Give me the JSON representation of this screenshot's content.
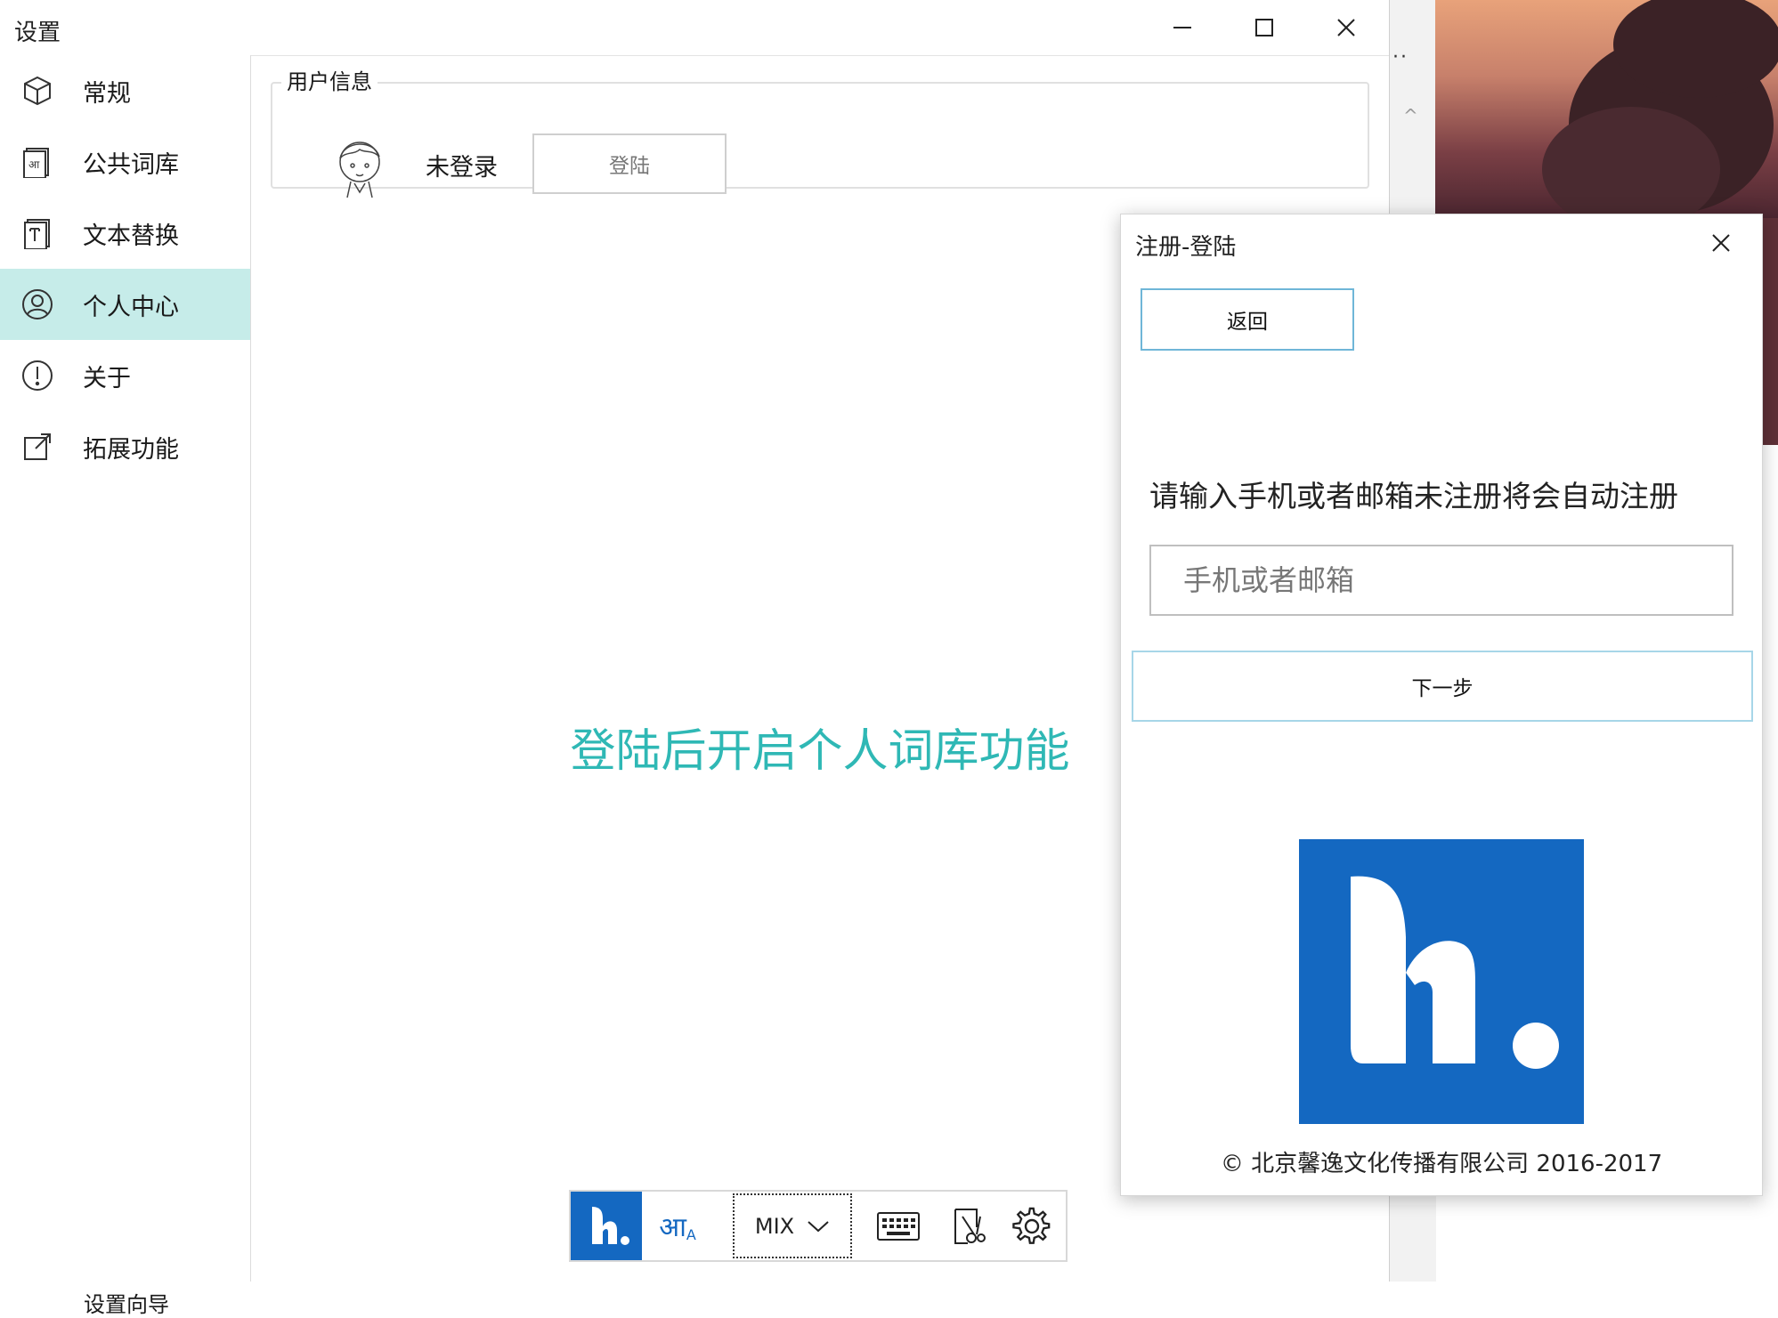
{
  "main_window": {
    "title": "设置",
    "controls": {
      "minimize": "minimize",
      "maximize": "maximize",
      "close": "close"
    }
  },
  "sidebar": {
    "items": [
      {
        "label": "常规",
        "icon": "cube-icon",
        "active": false
      },
      {
        "label": "公共词库",
        "icon": "dictionary-icon",
        "active": false
      },
      {
        "label": "文本替换",
        "icon": "text-replace-icon",
        "active": false
      },
      {
        "label": "个人中心",
        "icon": "user-icon",
        "active": true
      },
      {
        "label": "关于",
        "icon": "info-icon",
        "active": false
      },
      {
        "label": "拓展功能",
        "icon": "external-link-icon",
        "active": false
      }
    ],
    "wizard": "设置向导"
  },
  "user_info": {
    "legend": "用户信息",
    "status": "未登录",
    "login_button": "登陆",
    "avatar": "avatar-sketch"
  },
  "main_message": "登陆后开启个人词库功能",
  "toolbar": {
    "logo_icon": "h-logo-icon",
    "lang_glyph": "आ",
    "lang_sub": "A",
    "mode": "MIX",
    "icons": [
      "keyboard-icon",
      "cut-icon",
      "settings-icon"
    ]
  },
  "login_dialog": {
    "title": "注册-登陆",
    "back_button": "返回",
    "prompt": "请输入手机或者邮箱未注册将会自动注册",
    "input_placeholder": "手机或者邮箱",
    "input_value": "",
    "next_button": "下一步",
    "copyright": "© 北京馨逸文化传播有限公司 2016-2017"
  },
  "colors": {
    "accent": "#2fb8b5",
    "active_nav_bg": "#c6ece9",
    "brand_blue": "#1468c1"
  }
}
